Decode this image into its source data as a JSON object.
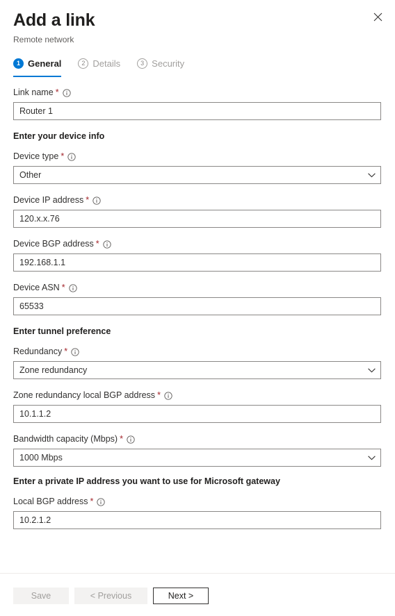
{
  "header": {
    "title": "Add a link",
    "subtitle": "Remote network",
    "close_label": "Close"
  },
  "tabs": [
    {
      "num": "1",
      "label": "General",
      "state": "active"
    },
    {
      "num": "2",
      "label": "Details",
      "state": "inactive"
    },
    {
      "num": "3",
      "label": "Security",
      "state": "inactive"
    }
  ],
  "form": {
    "link_name": {
      "label": "Link name",
      "required": "*",
      "value": "Router 1"
    },
    "section_device": "Enter your device info",
    "device_type": {
      "label": "Device type",
      "required": "*",
      "value": "Other"
    },
    "device_ip": {
      "label": "Device IP address",
      "required": "*",
      "value": "120.x.x.76"
    },
    "device_bgp": {
      "label": "Device BGP address",
      "required": "*",
      "value": "192.168.1.1"
    },
    "device_asn": {
      "label": "Device ASN",
      "required": "*",
      "value": "65533"
    },
    "section_tunnel": "Enter tunnel preference",
    "redundancy": {
      "label": "Redundancy",
      "required": "*",
      "value": "Zone redundancy"
    },
    "zone_local_bgp": {
      "label": "Zone redundancy local BGP address",
      "required": "*",
      "value": "10.1.1.2"
    },
    "bandwidth": {
      "label": "Bandwidth capacity (Mbps)",
      "required": "*",
      "value": "1000 Mbps"
    },
    "section_gateway": "Enter a private IP address you want to use for Microsoft gateway",
    "local_bgp": {
      "label": "Local BGP address",
      "required": "*",
      "value": "10.2.1.2"
    }
  },
  "footer": {
    "save": "Save",
    "previous": "< Previous",
    "next": "Next >"
  },
  "colors": {
    "accent": "#0078d4",
    "required": "#a4262c",
    "text": "#323130",
    "border": "#8a8886",
    "disabled_bg": "#f3f2f1",
    "disabled_text": "#a19f9d"
  }
}
